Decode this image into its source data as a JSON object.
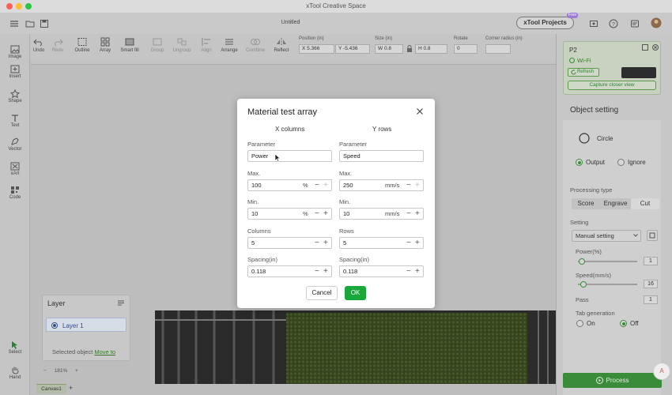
{
  "window": {
    "title": "xTool Creative Space"
  },
  "header": {
    "doc_title": "Untitled",
    "projects_button": "xTool Projects",
    "free_badge": "Free"
  },
  "toolbar": {
    "undo": "Undo",
    "redo": "Redo",
    "outline": "Outline",
    "array": "Array",
    "smart_fill": "Smart fill",
    "group": "Group",
    "ungroup": "Ungroup",
    "align": "Align",
    "arrange": "Arrange",
    "combine": "Combine",
    "reflect": "Reflect",
    "position_label": "Position (in)",
    "pos_x": "X  5.366",
    "pos_y": "Y  -5.436",
    "size_label": "Size (in)",
    "size_w": "W  0.8",
    "size_h": "H  0.8",
    "rotate_label": "Rotate",
    "rotate_value": "0",
    "corner_label": "Corner radius (in)",
    "corner_value": ""
  },
  "sidebar": {
    "image": "Image",
    "insert": "Insert",
    "shape": "Shape",
    "text": "Text",
    "vector": "Vector",
    "xart": "xArt",
    "code": "Code",
    "select": "Select",
    "hand": "Hand"
  },
  "layer_panel": {
    "title": "Layer",
    "layer_name": "Layer 1",
    "selected_text": "Selected object",
    "move_to": "Move to"
  },
  "bottom": {
    "zoom": "181%",
    "canvas_tab": "Canvas1",
    "add_tab": "+"
  },
  "device": {
    "name": "P2",
    "connection": "Wi-Fi",
    "refresh": "Refresh",
    "capture": "Capture closer view"
  },
  "object_setting": {
    "title": "Object setting",
    "shape_name": "Circle",
    "output": "Output",
    "ignore": "Ignore",
    "processing_type_label": "Processing type",
    "processing_types": [
      "Score",
      "Engrave",
      "Cut"
    ],
    "selected_processing_type": "Cut",
    "setting_label": "Setting",
    "setting_value": "Manual setting",
    "power_label": "Power(%)",
    "power_value": "1",
    "power_level": 0.01,
    "speed_label": "Speed(mm/s)",
    "speed_value": "16",
    "speed_level": 0.04,
    "pass_label": "Pass",
    "pass_value": "1",
    "tab_gen_label": "Tab generation",
    "tab_on": "On",
    "tab_off": "Off",
    "process_button": "Process"
  },
  "modal": {
    "title": "Material test array",
    "x_header": "X columns",
    "y_header": "Y rows",
    "param_label": "Parameter",
    "x_param": "Power",
    "y_param": "Speed",
    "max_label": "Max.",
    "min_label": "Min.",
    "x_max": "100",
    "x_min": "10",
    "x_unit": "%",
    "y_max": "250",
    "y_min": "10",
    "y_unit": "mm/s",
    "columns_label": "Columns",
    "rows_label": "Rows",
    "columns_value": "5",
    "rows_value": "5",
    "spacing_label": "Spacing(in)",
    "x_spacing": "0.118",
    "y_spacing": "0.118",
    "cancel": "Cancel",
    "ok": "OK"
  },
  "colors": {
    "accent": "#18a83a",
    "process": "#3a8c3a",
    "layer_select": "#2a4a8a"
  }
}
